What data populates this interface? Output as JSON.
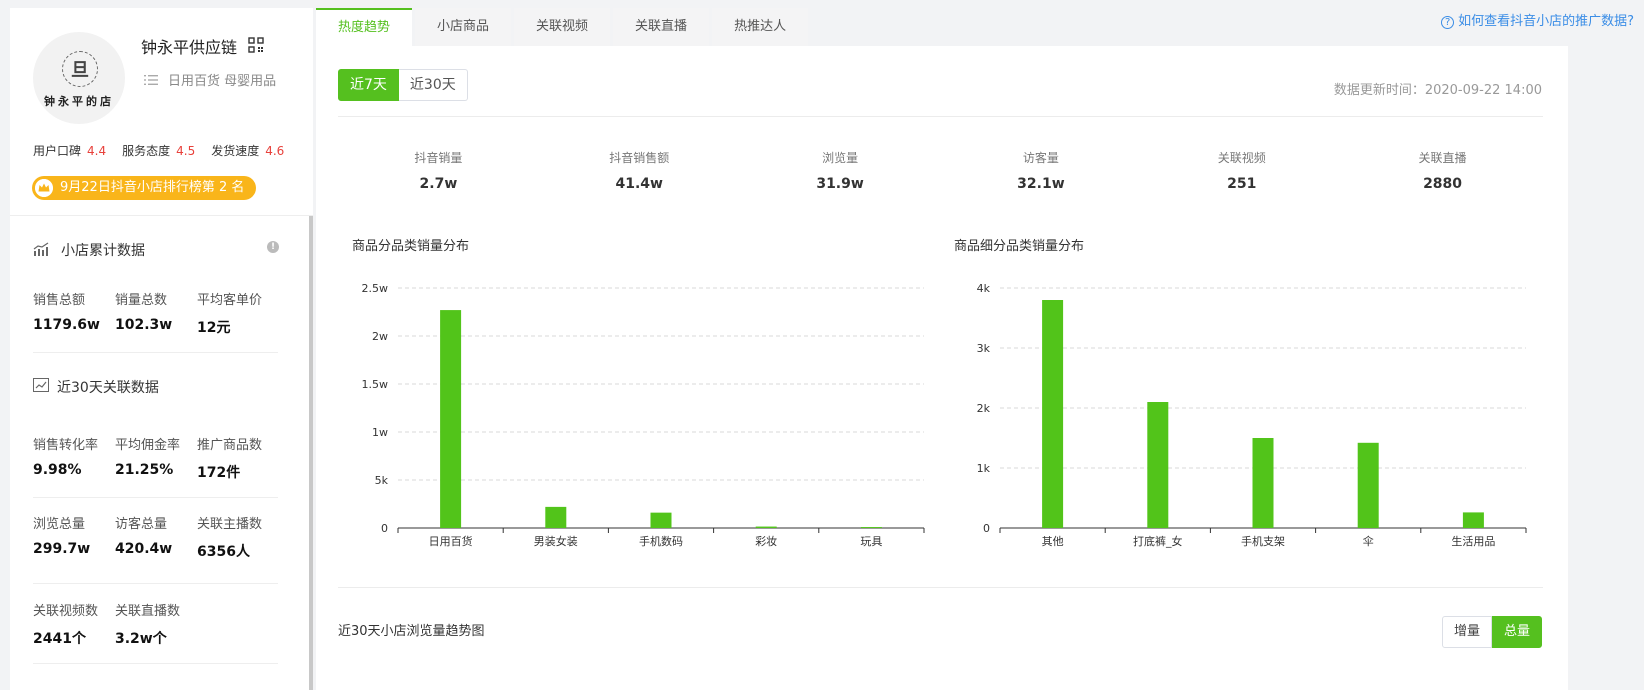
{
  "shop": {
    "logo_mark": "旦",
    "logo_text": "钟永平的店",
    "name": "钟永平供应链",
    "categories": "日用百货 母婴用品",
    "ratings": [
      {
        "label": "用户口碑",
        "value": "4.4"
      },
      {
        "label": "服务态度",
        "value": "4.5"
      },
      {
        "label": "发货速度",
        "value": "4.6"
      }
    ],
    "rank_text": "9月22日抖音小店排行榜第 2 名",
    "colors": {
      "rank_badge": "#f9b51a",
      "rating_value": "#e8413b"
    }
  },
  "cumulative": {
    "title": "小店累计数据",
    "info_icon": "!",
    "metrics": [
      {
        "label": "销售总额",
        "value": "1179.6w"
      },
      {
        "label": "销量总数",
        "value": "102.3w"
      },
      {
        "label": "平均客单价",
        "value": "12元"
      }
    ]
  },
  "related30": {
    "title": "近30天关联数据",
    "rows": [
      [
        {
          "label": "销售转化率",
          "value": "9.98%"
        },
        {
          "label": "平均佣金率",
          "value": "21.25%"
        },
        {
          "label": "推广商品数",
          "value": "172件"
        }
      ],
      [
        {
          "label": "浏览总量",
          "value": "299.7w"
        },
        {
          "label": "访客总量",
          "value": "420.4w"
        },
        {
          "label": "关联主播数",
          "value": "6356人"
        }
      ],
      [
        {
          "label": "关联视频数",
          "value": "2441个"
        },
        {
          "label": "关联直播数",
          "value": "3.2w个"
        }
      ]
    ]
  },
  "tabs": [
    "热度趋势",
    "小店商品",
    "关联视频",
    "关联直播",
    "热推达人"
  ],
  "help": {
    "icon": "?",
    "text": "如何查看抖音小店的推广数据?"
  },
  "range": {
    "options": [
      "近7天",
      "近30天"
    ],
    "selected": "近7天"
  },
  "update_time": "数据更新时间：2020-09-22 14:00",
  "kpis": [
    {
      "label": "抖音销量",
      "value": "2.7w"
    },
    {
      "label": "抖音销售额",
      "value": "41.4w"
    },
    {
      "label": "浏览量",
      "value": "31.9w"
    },
    {
      "label": "访客量",
      "value": "32.1w"
    },
    {
      "label": "关联视频",
      "value": "251"
    },
    {
      "label": "关联直播",
      "value": "2880"
    }
  ],
  "chart_data": [
    {
      "type": "bar",
      "title": "商品分品类销量分布",
      "categories": [
        "日用百货",
        "男装女装",
        "手机数码",
        "彩妆",
        "玩具"
      ],
      "values": [
        22700,
        2200,
        1600,
        150,
        100
      ],
      "yticks": [
        "0",
        "5k",
        "1w",
        "1.5w",
        "2w",
        "2.5w"
      ],
      "ylim": [
        0,
        25000
      ],
      "grid": true,
      "color": "#52c41a"
    },
    {
      "type": "bar",
      "title": "商品细分品类销量分布",
      "categories": [
        "其他",
        "打底裤_女",
        "手机支架",
        "伞",
        "生活用品"
      ],
      "values": [
        3800,
        2100,
        1500,
        1420,
        260
      ],
      "yticks": [
        "0",
        "1k",
        "2k",
        "3k",
        "4k"
      ],
      "ylim": [
        0,
        4000
      ],
      "grid": true,
      "color": "#52c41a"
    }
  ],
  "trend": {
    "title": "近30天小店浏览量趋势图",
    "modes": [
      "增量",
      "总量"
    ],
    "selected": "总量"
  }
}
